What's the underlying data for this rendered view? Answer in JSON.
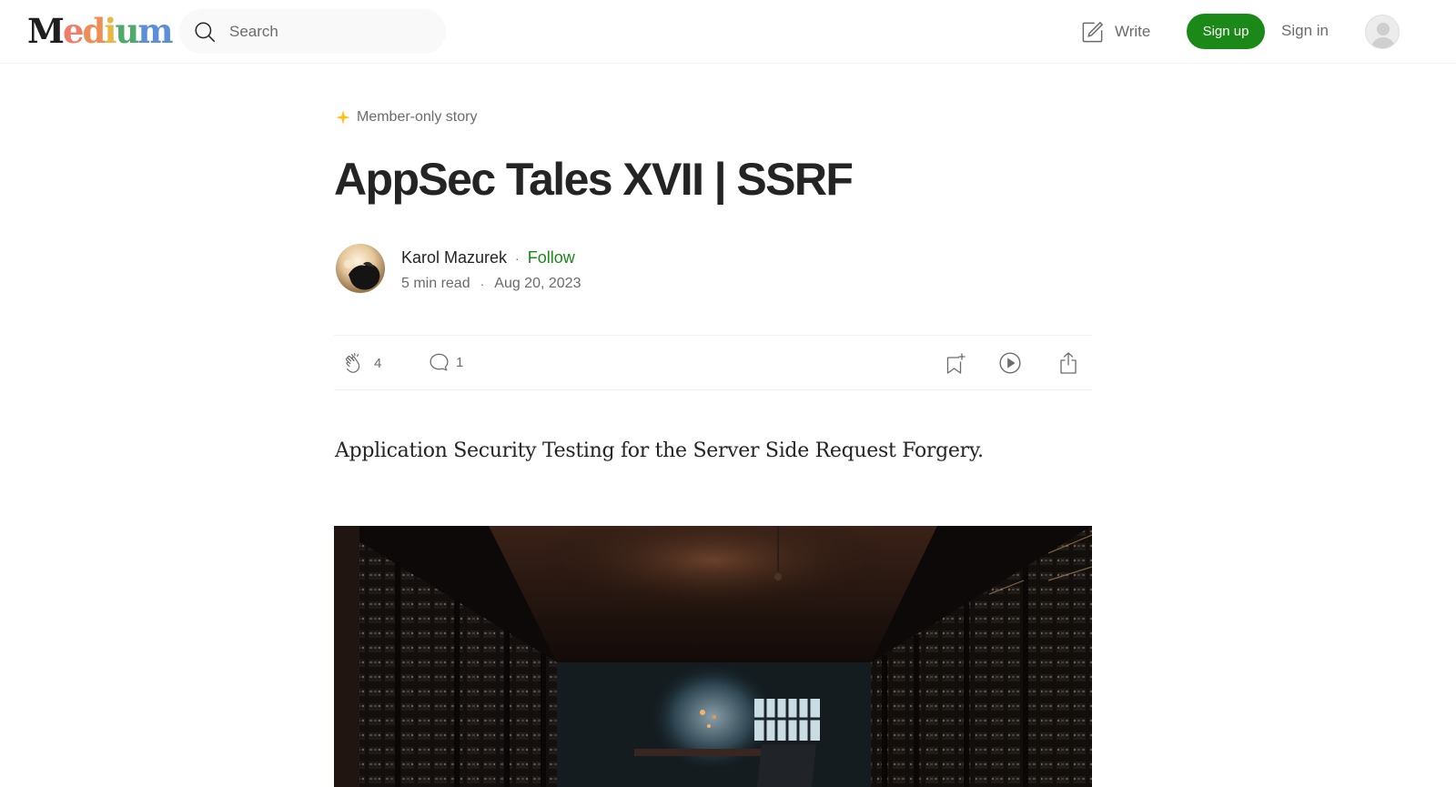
{
  "header": {
    "logo_text": "Medium",
    "logo_letters": [
      {
        "ch": "M",
        "color": "#1f1f1f"
      },
      {
        "ch": "e",
        "color": "#f07c6a"
      },
      {
        "ch": "d",
        "color": "#ec8e56"
      },
      {
        "ch": "i",
        "color": "#e8b844"
      },
      {
        "ch": "u",
        "color": "#4fa96a"
      },
      {
        "ch": "m",
        "color": "#5b8fd8"
      }
    ],
    "search_placeholder": "Search",
    "write_label": "Write",
    "signup_label": "Sign up",
    "signin_label": "Sign in"
  },
  "article": {
    "member_label": "Member-only story",
    "title": "AppSec Tales XVII | SSRF",
    "author": "Karol Mazurek",
    "follow_label": "Follow",
    "read_time": "5 min read",
    "date": "Aug 20, 2023",
    "claps": "4",
    "responses": "1",
    "subtitle": "Application Security Testing for the Server Side Request Forgery."
  },
  "colors": {
    "accent_green": "#1a8917",
    "member_star": "#ffc017",
    "text_primary": "#242424",
    "text_secondary": "#6b6b6b"
  },
  "icons": [
    "search-icon",
    "write-icon",
    "user-avatar-icon",
    "member-star-icon",
    "clap-icon",
    "response-icon",
    "bookmark-add-icon",
    "listen-play-icon",
    "share-icon"
  ]
}
